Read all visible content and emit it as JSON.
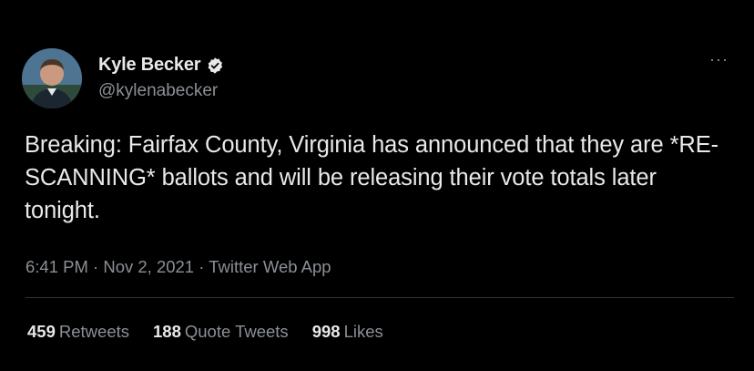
{
  "author": {
    "name": "Kyle Becker",
    "handle": "@kylenabecker",
    "verified": true
  },
  "more_icon": "···",
  "tweet": {
    "text": "Breaking: Fairfax County, Virginia has announced that they are *RE-SCANNING* ballots and will be releasing their vote totals later tonight.",
    "timestamp": "6:41 PM · Nov 2, 2021 · Twitter Web App"
  },
  "stats": [
    {
      "count": "459",
      "label": "Retweets"
    },
    {
      "count": "188",
      "label": "Quote Tweets"
    },
    {
      "count": "998",
      "label": "Likes"
    }
  ],
  "colors": {
    "background": "#000000",
    "text": "#e7e9ea",
    "muted": "#8b9096",
    "verified": "#1d9bf0",
    "divider": "#2f3336"
  }
}
